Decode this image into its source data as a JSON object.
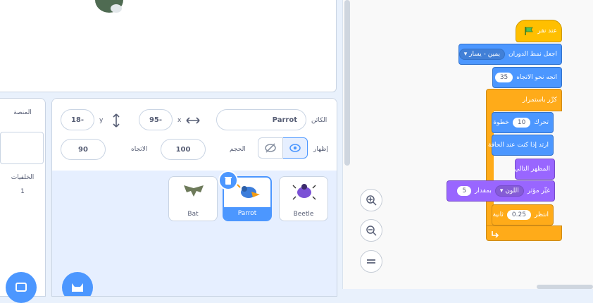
{
  "stage_panel": {
    "title": "المنصة",
    "backdrops_label": "الخلفيات",
    "backdrops_count": "1"
  },
  "sprite_info": {
    "sprite_label": "الكائن",
    "sprite_name": "Parrot",
    "x_label": "x",
    "x_value": "95-",
    "y_label": "y",
    "y_value": "18-",
    "show_label": "إظهار",
    "size_label": "الحجم",
    "size_value": "100",
    "direction_label": "الاتجاه",
    "direction_value": "90"
  },
  "sprites": [
    {
      "name": "Beetle"
    },
    {
      "name": "Parrot",
      "selected": true
    },
    {
      "name": "Bat"
    }
  ],
  "script": {
    "hat": "عند نقر",
    "rotation_label": "اجعل نمط الدوران",
    "rotation_value": "يمين - يسار",
    "point_label": "اتجه نحو الاتجاه",
    "point_value": "35",
    "forever_label": "كرِّر باستمرار",
    "move_label": "تحرك",
    "move_value": "10",
    "move_unit": "خطوة",
    "bounce_label": "ارتد إذا كنت عند الحافة",
    "next_costume_label": "المظهر التالي",
    "effect_label": "غيِّر مؤثر",
    "effect_value": "اللون",
    "effect_by": "بمقدار",
    "effect_amount": "5",
    "wait_label": "انتظر",
    "wait_value": "0.25",
    "wait_unit": "ثانية"
  },
  "colors": {
    "motion": "#4c97ff",
    "control": "#ffab19",
    "events": "#ffbf00",
    "looks": "#9966ff",
    "accent": "#4c97ff"
  }
}
